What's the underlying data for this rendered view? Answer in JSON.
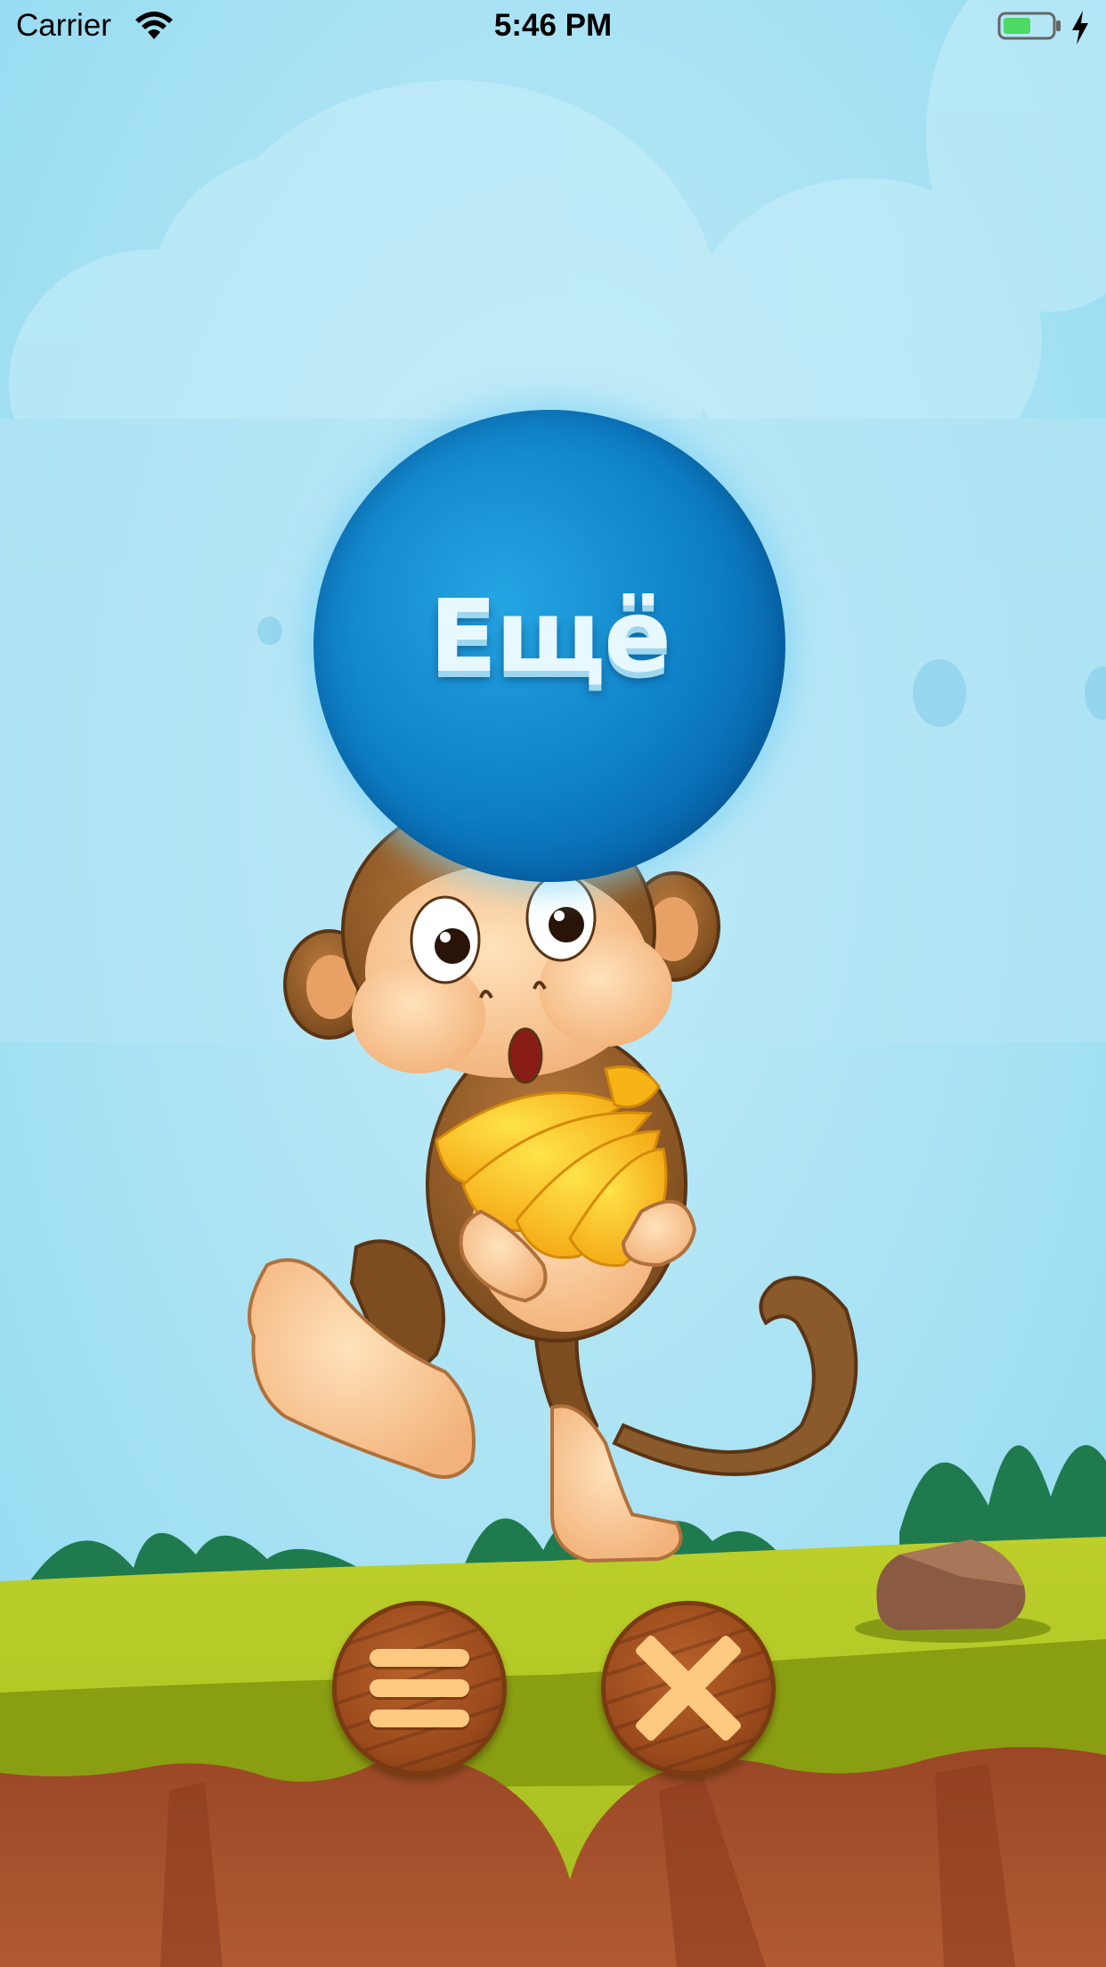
{
  "status_bar": {
    "carrier": "Carrier",
    "time": "5:46 PM",
    "battery_color": "#4cd964"
  },
  "game": {
    "more_button_label": "Ещё",
    "menu_icon": "hamburger-icon",
    "close_icon": "close-x-icon"
  },
  "colors": {
    "sky": "#a6e0f2",
    "bubble_blue": "#0d7fc7",
    "grass": "#b2c821",
    "soil": "#a9522c",
    "wood": "#9a4a1c",
    "icon_fill": "#fbc97f"
  }
}
